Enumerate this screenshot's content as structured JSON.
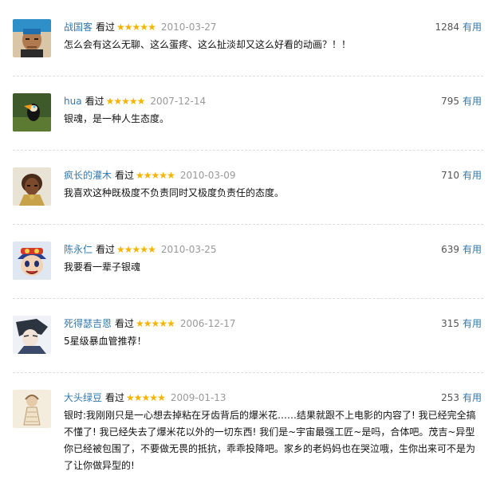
{
  "comments": [
    {
      "user": "战国客",
      "watched": "看过",
      "stars": "★★★★★",
      "date": "2010-03-27",
      "votes": "1284",
      "useful": "有用",
      "content": "怎么会有这么无聊、这么蛋疼、这么扯淡却又这么好看的动画？！！"
    },
    {
      "user": "hua",
      "watched": "看过",
      "stars": "★★★★★",
      "date": "2007-12-14",
      "votes": "795",
      "useful": "有用",
      "content": "银魂，是一种人生态度。"
    },
    {
      "user": "疯长的灌木",
      "watched": "看过",
      "stars": "★★★★★",
      "date": "2010-03-09",
      "votes": "710",
      "useful": "有用",
      "content": "我喜欢这种既极度不负责同时又极度负责任的态度。"
    },
    {
      "user": "陈永仁",
      "watched": "看过",
      "stars": "★★★★★",
      "date": "2010-03-25",
      "votes": "639",
      "useful": "有用",
      "content": "我要看一辈子银魂"
    },
    {
      "user": "死得瑟吉恩",
      "watched": "看过",
      "stars": "★★★★★",
      "date": "2006-12-17",
      "votes": "315",
      "useful": "有用",
      "content": "5星级暴血管推荐！"
    },
    {
      "user": "大头绿豆",
      "watched": "看过",
      "stars": "★★★★★",
      "date": "2009-01-13",
      "votes": "253",
      "useful": "有用",
      "content": "银时:我刚刚只是一心想去掉粘在牙齿背后的爆米花……结果就跟不上电影的内容了! 我已经完全搞不懂了! 我已经失去了爆米花以外的一切东西! 我们是~宇宙最强工匠~是吗，合体吧。茂吉~异型你已经被包围了，不要做无畏的抵抗，乖乖投降吧。家乡的老妈妈也在哭泣哦，生你出来可不是为了让你做异型的!"
    }
  ],
  "colors": {
    "link": "#3377aa",
    "star": "#f4b400",
    "date": "#999999"
  }
}
